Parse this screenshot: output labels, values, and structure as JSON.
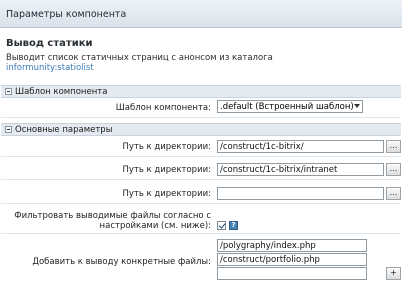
{
  "window": {
    "title": "Параметры компонента"
  },
  "component": {
    "name": "Вывод статики",
    "description": "Выводит список статичных страниц с анонсом из каталога",
    "code": "informunity:statiolist"
  },
  "sections": {
    "template": {
      "title": "Шаблон компонента"
    },
    "main": {
      "title": "Основные параметры"
    }
  },
  "fields": {
    "template_label": "Шаблон компонента:",
    "template_value": ".default (Встроенный шаблон)",
    "path_label": "Путь к директории:",
    "path1": "/construct/1c-bitrix/",
    "path2": "/construct/1c-bitrix/intranet",
    "path3": "",
    "filter_label_line1": "Фильтровать выводимые файлы согласно с",
    "filter_label_line2": "настройками (см. ниже):",
    "add_label": "Добавить к выводу конкретные файлы:",
    "add_file1": "/polygraphy/index.php",
    "add_file2": "/construct/portfolio.php",
    "add_file3": "",
    "browse_label": "...",
    "add_button_label": "+",
    "help_glyph": "?"
  }
}
